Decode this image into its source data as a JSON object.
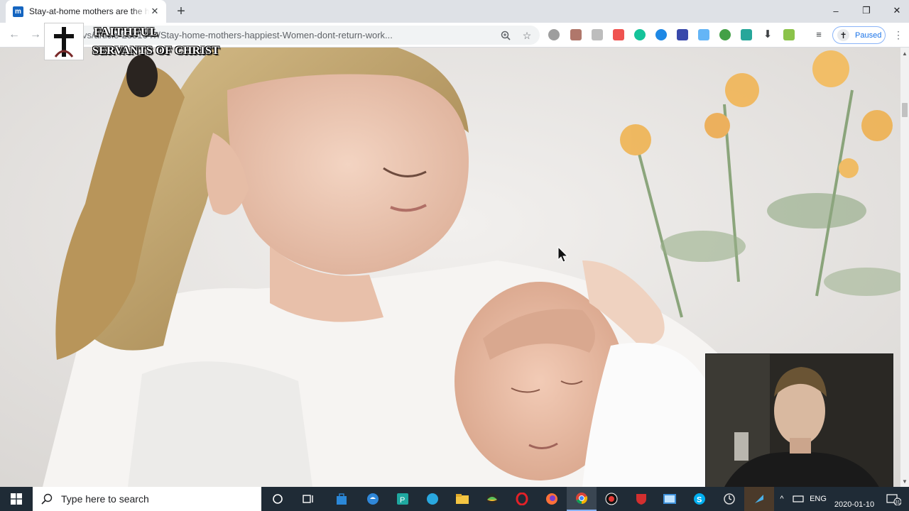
{
  "browser": {
    "tab": {
      "favicon_letter": "m",
      "title": "Stay-at-home mothers are the happiest"
    },
    "url": "vs/article-2381647/Stay-home-mothers-happiest-Women-dont-return-work...",
    "profile_status": "Paused",
    "window_controls": {
      "minimize": "–",
      "maximize": "❐",
      "close": "✕"
    }
  },
  "watermark": {
    "line1": "FAITHFUL",
    "line2": "SERVANTS OF CHRIST"
  },
  "taskbar": {
    "search_placeholder": "Type here to search",
    "language": "ENG",
    "date": "2020-01-10",
    "notification_count": "31"
  },
  "colors": {
    "tabstrip": "#dee1e6",
    "accent_blue": "#1a73e8",
    "taskbar": "#1f2b36"
  }
}
